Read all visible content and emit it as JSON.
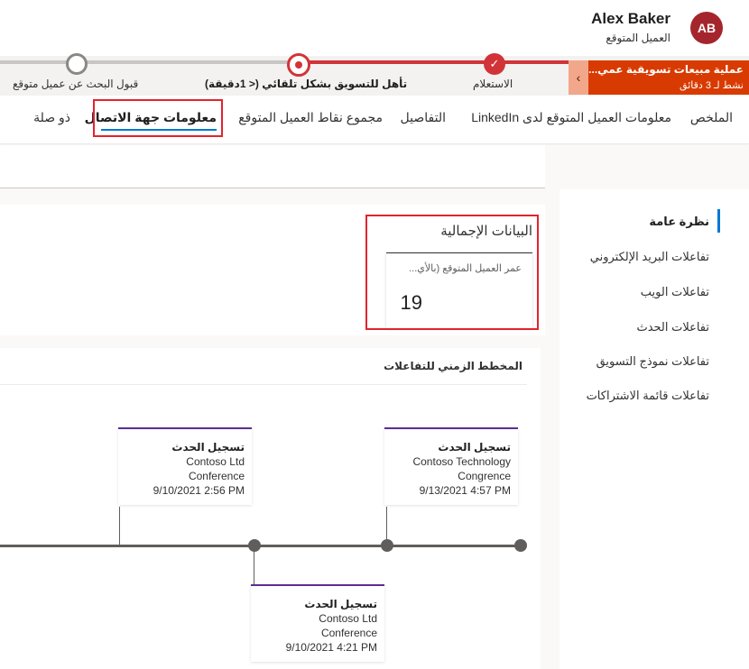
{
  "user": {
    "initials": "AB",
    "name": "Alex Baker",
    "role": "العميل المتوقع"
  },
  "process": {
    "active_name": "عملية مبيعات تسويقية عمي...",
    "active_time": "نشط لـ 3 دقائق",
    "stages": [
      {
        "label": "الاستعلام",
        "state": "done"
      },
      {
        "label": "تأهل للتسويق بشكل تلقائي  (< 1دقيقة)",
        "state": "active"
      },
      {
        "label": "قبول البحث عن عميل متوقع",
        "state": "pending"
      }
    ]
  },
  "tabs": [
    {
      "label": "الملخص"
    },
    {
      "label": "معلومات العميل المتوقع لدى LinkedIn"
    },
    {
      "label": "التفاصيل"
    },
    {
      "label": "مجموع نقاط العميل المتوقع"
    },
    {
      "label": "معلومات جهة الاتصال",
      "selected": true
    },
    {
      "label": "ذو صلة"
    }
  ],
  "side_nav": [
    {
      "label": "نظرة عامة",
      "selected": true
    },
    {
      "label": "تفاعلات البريد الإلكتروني"
    },
    {
      "label": "تفاعلات الويب"
    },
    {
      "label": "تفاعلات الحدث"
    },
    {
      "label": "تفاعلات نموذج التسويق"
    },
    {
      "label": "تفاعلات قائمة الاشتراكات"
    }
  ],
  "aggregate": {
    "title": "البيانات الإجمالية",
    "tile_label": "عمر العميل المتوقع (بالأي...",
    "tile_value": "19"
  },
  "timeline": {
    "title": "المخطط الزمني للتفاعلات",
    "events": [
      {
        "type": "تسجيل الحدث",
        "company": "Contoso Technology",
        "event": "Congrence",
        "date": "9/13/2021 4:57 PM"
      },
      {
        "type": "تسجيل الحدث",
        "company": "Contoso Ltd",
        "event": "Conference",
        "date": "9/10/2021 2:56 PM"
      },
      {
        "type": "تسجيل الحدث",
        "company": "Contoso Ltd",
        "event": "Conference",
        "date": "9/10/2021 4:21 PM"
      }
    ]
  },
  "colors": {
    "accent": "#d13438",
    "active_stage": "#d83b01",
    "tab_underline": "#0078d4",
    "highlight": "#e3232d",
    "event_border": "#5c2d91"
  }
}
